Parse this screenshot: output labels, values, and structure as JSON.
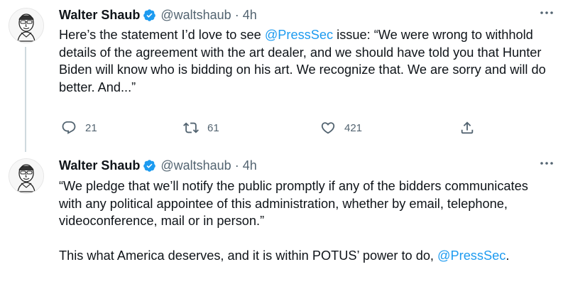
{
  "tweets": [
    {
      "author": {
        "name": "Walter Shaub",
        "handle": "@waltshaub",
        "verified_icon": "verified-badge-icon",
        "avatar": "avatar-caricature"
      },
      "separator": "·",
      "time": "4h",
      "text_segments": [
        {
          "type": "text",
          "value": "Here’s the statement I’d love to see "
        },
        {
          "type": "mention",
          "value": "@PressSec"
        },
        {
          "type": "text",
          "value": " issue: “We were wrong to withhold details of the agreement with the art dealer, and we should have told you that Hunter Biden will know who is bidding on his art. We recognize that. We are sorry and will do better. And...”"
        }
      ],
      "actions": {
        "reply_count": "21",
        "retweet_count": "61",
        "like_count": "421"
      }
    },
    {
      "author": {
        "name": "Walter Shaub",
        "handle": "@waltshaub",
        "verified_icon": "verified-badge-icon",
        "avatar": "avatar-caricature"
      },
      "separator": "·",
      "time": "4h",
      "text_segments": [
        {
          "type": "text",
          "value": "“We pledge that we’ll notify the public promptly if any of the bidders communicates with any political appointee of this administration, whether by email, telephone, videoconference, mail or in person.”\n\nThis what America deserves, and it is within POTUS’ power to do, "
        },
        {
          "type": "mention",
          "value": "@PressSec"
        },
        {
          "type": "text",
          "value": "."
        }
      ]
    }
  ],
  "colors": {
    "mention": "#1d9bf0",
    "verified": "#1d9bf0",
    "secondary_text": "#536471",
    "thread_line": "#cfd9de"
  }
}
